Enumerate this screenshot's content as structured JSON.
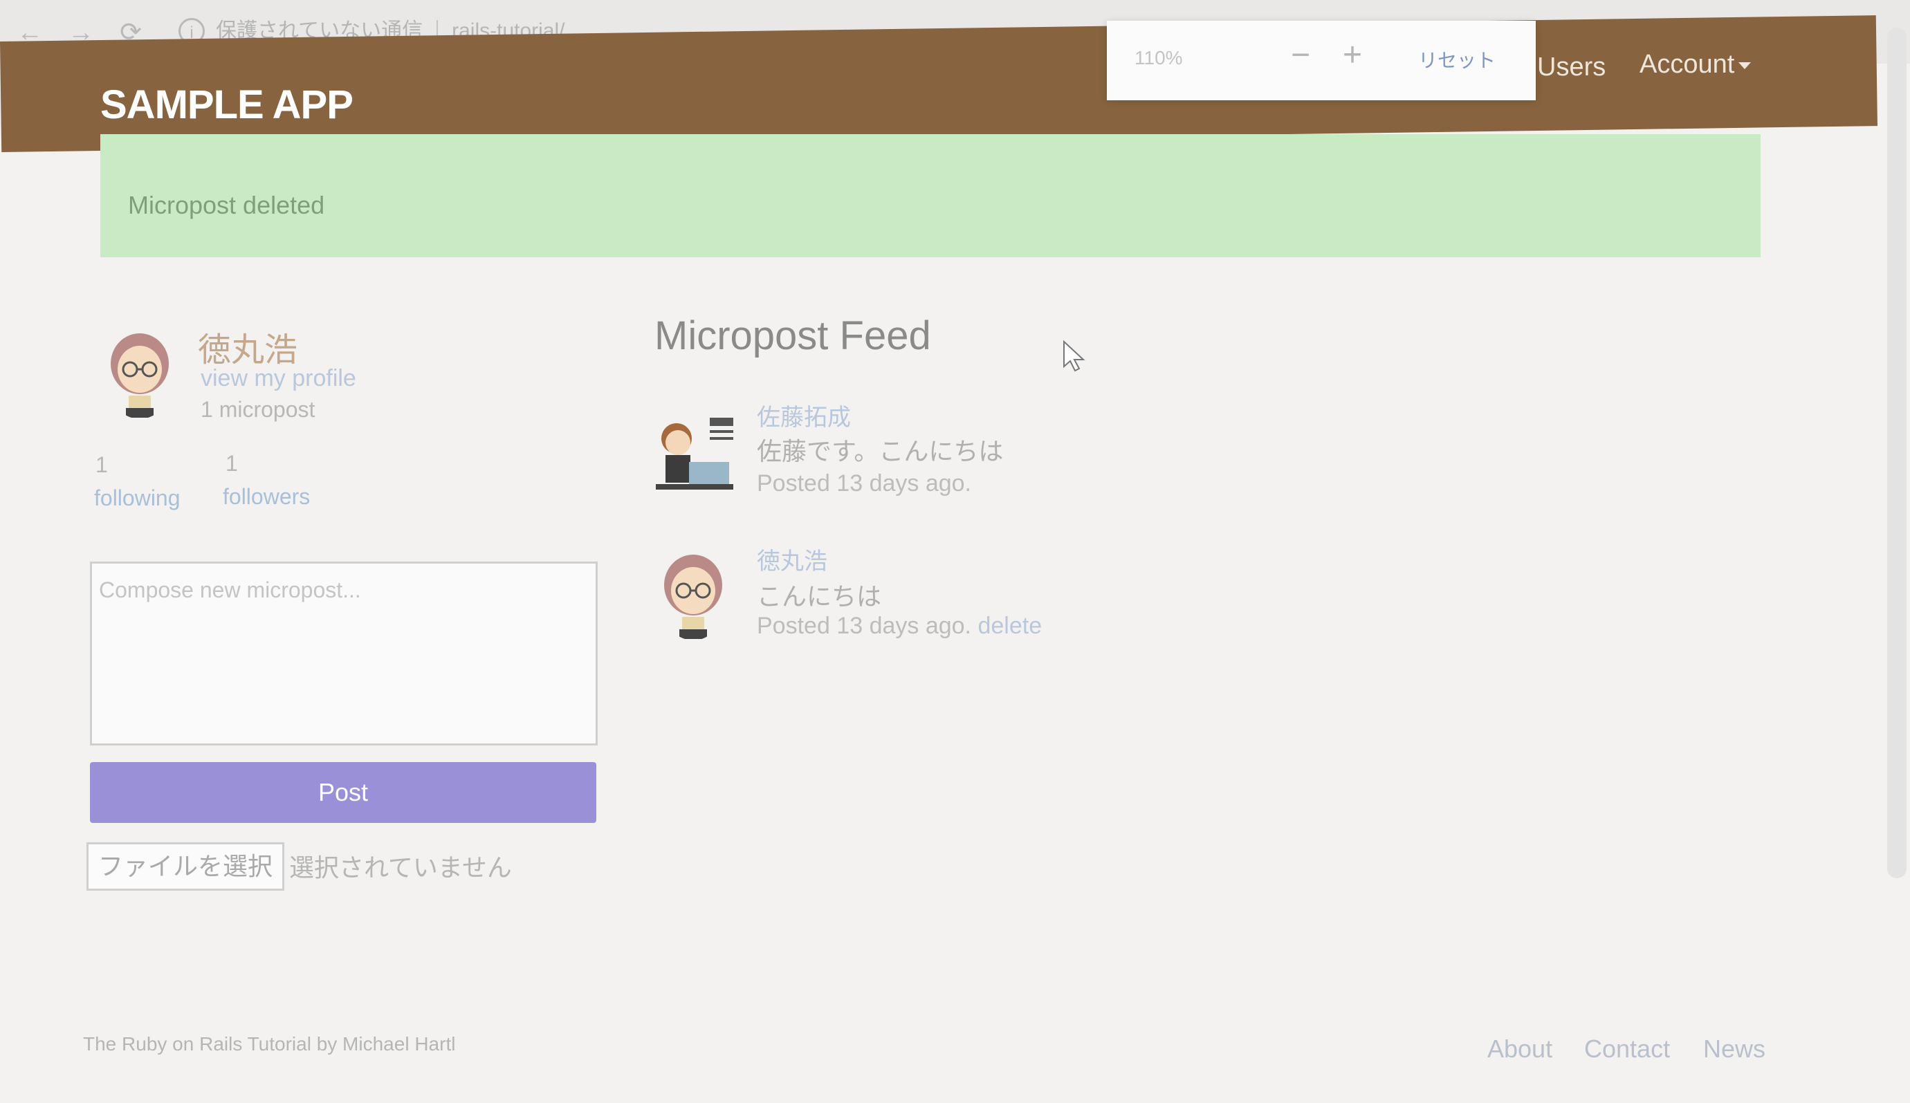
{
  "browser": {
    "back_icon": "←",
    "forward_icon": "→",
    "reload_icon": "⟳",
    "security_text": "保護されていない通信",
    "url": "rails-tutorial/"
  },
  "zoom": {
    "level": "110%",
    "minus": "−",
    "plus": "+",
    "reset": "リセット"
  },
  "header": {
    "logo": "SAMPLE APP",
    "users_link": "Users",
    "account_link": "Account"
  },
  "alert": {
    "message": "Micropost deleted",
    "color": "#c9ebc4"
  },
  "user_info": {
    "name": "徳丸浩",
    "profile_link": "view my profile",
    "microposts": "1 micropost",
    "following_count": "1",
    "following_label": "following",
    "followers_count": "1",
    "followers_label": "followers"
  },
  "compose": {
    "placeholder": "Compose new micropost...",
    "post_button": "Post",
    "file_button": "ファイルを選択",
    "file_status": "選択されていません"
  },
  "feed": {
    "title": "Micropost Feed",
    "items": [
      {
        "user": "佐藤拓成",
        "content": "佐藤です。こんにちは",
        "timestamp": "Posted 13 days ago.",
        "delete": ""
      },
      {
        "user": "徳丸浩",
        "content": "こんにちは",
        "timestamp": "Posted 13 days ago.",
        "delete": "delete"
      }
    ]
  },
  "footer": {
    "credit": "The Ruby on Rails Tutorial by Michael Hartl",
    "links": [
      "About",
      "Contact",
      "News"
    ]
  },
  "colors": {
    "header": "#87643f",
    "post_button": "#9a90d8"
  }
}
